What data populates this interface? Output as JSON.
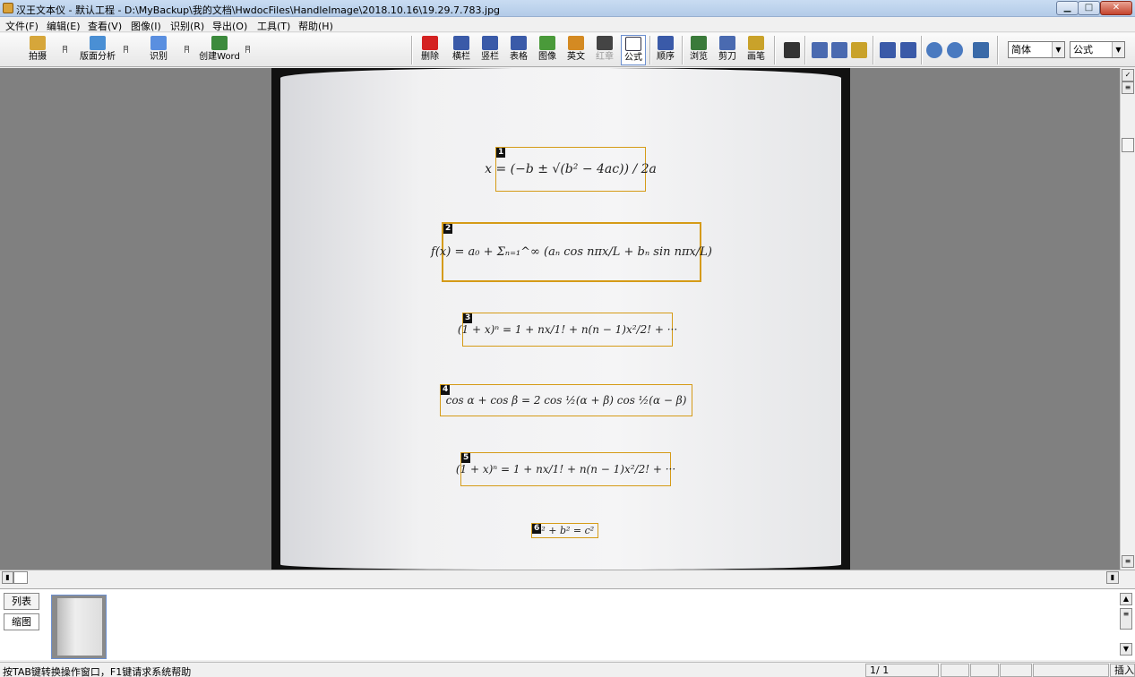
{
  "window": {
    "title": "汉王文本仪 - 默认工程 - D:\\MyBackup\\我的文档\\HwdocFiles\\HandleImage\\2018.10.16\\19.29.7.783.jpg",
    "minimize": "▁",
    "maximize": "□",
    "close": "✕"
  },
  "menu": [
    "文件(F)",
    "编辑(E)",
    "查看(V)",
    "图像(I)",
    "识别(R)",
    "导出(O)",
    "工具(T)",
    "帮助(H)"
  ],
  "toolbar_left": [
    {
      "label": "拍摄",
      "icon": "camera-icon",
      "color": "#d6a63a"
    },
    {
      "label": "版面分析",
      "icon": "layout-analysis-icon",
      "color": "#4a8fd4"
    },
    {
      "label": "识别",
      "icon": "recognize-icon",
      "color": "#5a8fe0"
    },
    {
      "label": "创建Word",
      "icon": "word-icon",
      "color": "#3c8a3c"
    }
  ],
  "toolbar_right": [
    {
      "label": "删除",
      "icon": "delete-x-icon",
      "color": "#d42222"
    },
    {
      "label": "横栏",
      "icon": "horizontal-column-icon",
      "color": "#3a5aa8"
    },
    {
      "label": "竖栏",
      "icon": "vertical-column-icon",
      "color": "#3a5aa8"
    },
    {
      "label": "表格",
      "icon": "table-icon",
      "color": "#3a5aa8"
    },
    {
      "label": "图像",
      "icon": "image-icon",
      "color": "#4a9a3a"
    },
    {
      "label": "英文",
      "icon": "english-icon",
      "color": "#d48a22"
    },
    {
      "label": "红章",
      "icon": "stamp-icon",
      "color": "#444"
    },
    {
      "label": "公式",
      "icon": "formula-icon",
      "color": "#334"
    },
    {
      "label": "顺序",
      "icon": "order-icon",
      "color": "#3a5aa8"
    },
    {
      "label": "浏览",
      "icon": "browse-icon",
      "color": "#3a7a3a"
    },
    {
      "label": "剪刀",
      "icon": "scissors-icon",
      "color": "#4a6ab0"
    },
    {
      "label": "画笔",
      "icon": "brush-icon",
      "color": "#c9a22a"
    }
  ],
  "toolbar_extra_icons": [
    {
      "icon": "undo-icon",
      "color": "#333"
    },
    {
      "icon": "copy-icon",
      "color": "#4a6ab0"
    },
    {
      "icon": "duplicate-icon",
      "color": "#4a6ab0"
    },
    {
      "icon": "paste-icon",
      "color": "#c9a22a"
    },
    {
      "icon": "single-view-icon",
      "color": "#3a5aa8"
    },
    {
      "icon": "double-view-icon",
      "color": "#3a5aa8"
    },
    {
      "icon": "zoom-in-icon",
      "color": "#4a7ac0"
    },
    {
      "icon": "zoom-out-icon",
      "color": "#4a7ac0"
    },
    {
      "icon": "settings-icon",
      "color": "#3a6aa8"
    }
  ],
  "font_select": {
    "value": "简体"
  },
  "mode_select": {
    "value": "公式"
  },
  "formulas": [
    {
      "num": "1",
      "text": "x = (−b ± √(b² − 4ac)) / 2a"
    },
    {
      "num": "2",
      "text": "f(x) = a₀ + Σₙ₌₁^∞ (aₙ cos nπx/L + bₙ sin nπx/L)"
    },
    {
      "num": "3",
      "text": "(1 + x)ⁿ = 1 + nx/1! + n(n − 1)x²/2! + ···"
    },
    {
      "num": "4",
      "text": "cos α + cos β = 2 cos ½(α + β) cos ½(α − β)"
    },
    {
      "num": "5",
      "text": "(1 + x)ⁿ = 1 + nx/1! + n(n − 1)x²/2! + ···"
    },
    {
      "num": "6",
      "text": "a² + b² = c²"
    }
  ],
  "bottom_tabs": {
    "list": "列表",
    "thumbnail": "缩图"
  },
  "status": {
    "help": "按TAB键转换操作窗口，F1键请求系统帮助",
    "page": "1/    1",
    "mode": "插入"
  }
}
